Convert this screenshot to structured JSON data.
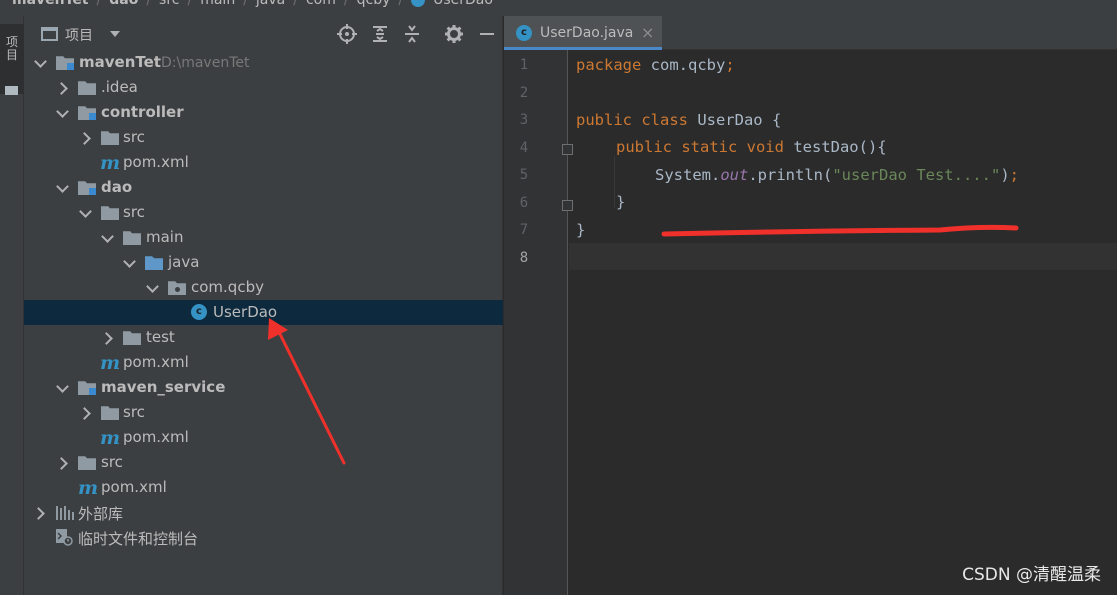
{
  "breadcrumb": [
    "mavenTet",
    "dao",
    "src",
    "main",
    "java",
    "com",
    "qcby",
    "UserDao"
  ],
  "toolstrip": {
    "project_label": "项目"
  },
  "project_panel": {
    "title": "项目",
    "tree": [
      {
        "label": "mavenTet",
        "path": "D:\\mavenTet"
      },
      {
        "label": ".idea"
      },
      {
        "label": "controller"
      },
      {
        "label": "src"
      },
      {
        "label": "pom.xml"
      },
      {
        "label": "dao"
      },
      {
        "label": "src"
      },
      {
        "label": "main"
      },
      {
        "label": "java"
      },
      {
        "label": "com.qcby"
      },
      {
        "label": "UserDao"
      },
      {
        "label": "test"
      },
      {
        "label": "pom.xml"
      },
      {
        "label": "maven_service"
      },
      {
        "label": "src"
      },
      {
        "label": "pom.xml"
      },
      {
        "label": "src"
      },
      {
        "label": "pom.xml"
      },
      {
        "label": "外部库"
      },
      {
        "label": "临时文件和控制台"
      }
    ]
  },
  "editor": {
    "tab_label": "UserDao.java",
    "tab_close": "×",
    "line_numbers": [
      "1",
      "2",
      "3",
      "4",
      "5",
      "6",
      "7",
      "8"
    ],
    "code": {
      "l1_kw": "package",
      "l1_rest": " com.qcby",
      "l1_semi": ";",
      "l3_kw": "public class",
      "l3_rest": " UserDao {",
      "l4_kw": "public static void",
      "l4_rest": " testDao(){",
      "l5_a": "System.",
      "l5_out": "out",
      "l5_b": ".println(",
      "l5_str": "\"userDao Test....\"",
      "l5_c": ")",
      "l5_semi": ";",
      "l6": "}",
      "l7": "}"
    }
  },
  "watermark": "CSDN @清醒温柔",
  "colors": {
    "panel_bg": "#3c3f41",
    "editor_bg": "#2b2b2b",
    "selection": "#0d293e",
    "keyword": "#cc7832",
    "string": "#6a8759",
    "static_field": "#9876aa",
    "annotation_red": "#f0302a"
  }
}
